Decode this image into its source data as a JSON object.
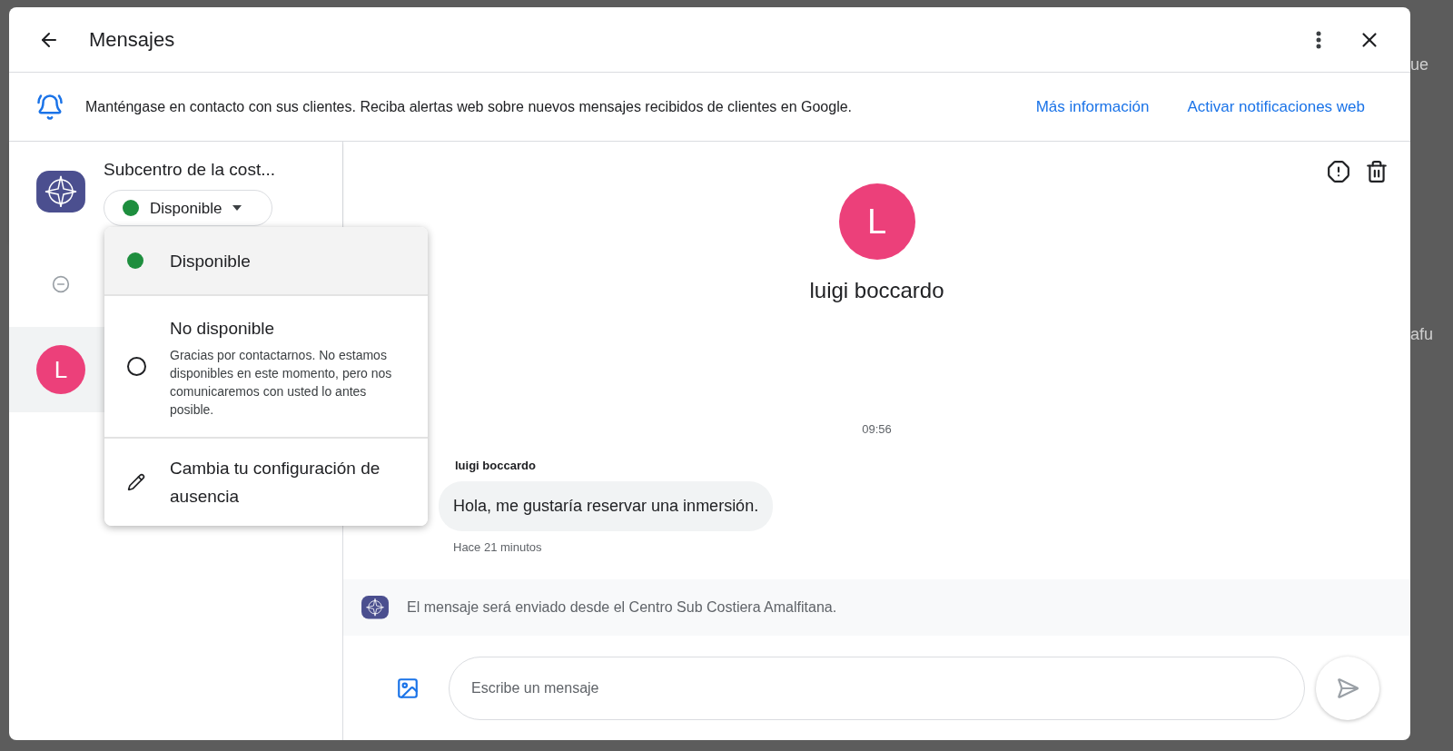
{
  "background_fragments": [
    "ue",
    "afu"
  ],
  "window": {
    "title": "Mensajes"
  },
  "banner": {
    "text": "Manténgase en contacto con sus clientes. Reciba alertas web sobre nuevos mensajes recibidos de clientes en Google.",
    "links": [
      "Más información",
      "Activar notificaciones web"
    ]
  },
  "business": {
    "name": "Subcentro de la cost...",
    "status": {
      "label": "Disponible",
      "color": "#1e8e3e"
    }
  },
  "conversations": [
    {
      "kind": "status",
      "selected": false
    },
    {
      "kind": "contact",
      "initial": "L",
      "color": "#ec407a",
      "selected": true
    }
  ],
  "status_menu": [
    {
      "kind": "dot",
      "label": "Disponible",
      "selected": true,
      "color": "#1e8e3e"
    },
    {
      "kind": "radio",
      "label": "No disponible",
      "description": "Gracias por contactarnos. No estamos disponibles en este momento, pero nos comunicaremos con usted lo antes posible.",
      "selected": false
    },
    {
      "kind": "action",
      "label": "Cambia tu configuración de ausencia"
    }
  ],
  "chat": {
    "contact": {
      "initial": "L",
      "name": "luigi boccardo",
      "color": "#ec407a"
    },
    "time": "09:56",
    "messages": [
      {
        "sender": "luigi boccardo",
        "text": "Hola, me gustaría reservar una inmersión.",
        "age": "Hace 21 minutos"
      }
    ],
    "sender_note": "El mensaje será enviado desde el Centro Sub Costiera Amalfitana.",
    "compose": {
      "placeholder": "Escribe un mensaje"
    }
  }
}
